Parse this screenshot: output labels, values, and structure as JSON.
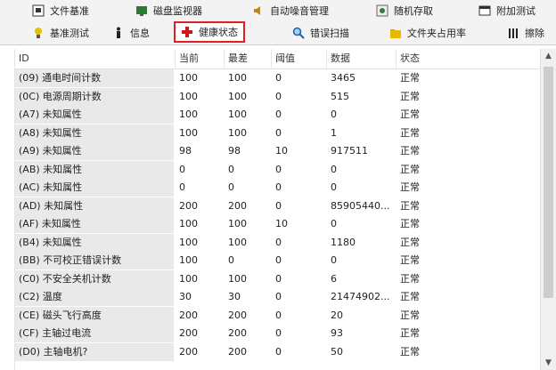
{
  "tabs": {
    "row1": [
      {
        "label": "文件基准",
        "icon": "benchmark-file-icon"
      },
      {
        "label": "磁盘监视器",
        "icon": "disk-monitor-icon"
      },
      {
        "label": "自动噪音管理",
        "icon": "speaker-icon"
      },
      {
        "label": "随机存取",
        "icon": "random-access-icon"
      },
      {
        "label": "附加测试",
        "icon": "extra-tests-icon"
      }
    ],
    "row2": [
      {
        "label": "基准测试",
        "icon": "lightbulb-icon"
      },
      {
        "label": "信息",
        "icon": "info-icon"
      },
      {
        "label": "健康状态",
        "icon": "red-cross-icon",
        "active": true
      },
      {
        "label": "错误扫描",
        "icon": "magnifier-icon"
      },
      {
        "label": "文件夹占用率",
        "icon": "folder-icon"
      },
      {
        "label": "擦除",
        "icon": "erase-icon"
      }
    ]
  },
  "table": {
    "columns": [
      "ID",
      "当前",
      "最差",
      "阈值",
      "数据",
      "状态"
    ],
    "rows": [
      [
        "(09) 通电时间计数",
        "100",
        "100",
        "0",
        "3465",
        "正常"
      ],
      [
        "(0C) 电源周期计数",
        "100",
        "100",
        "0",
        "515",
        "正常"
      ],
      [
        "(A7) 未知属性",
        "100",
        "100",
        "0",
        "0",
        "正常"
      ],
      [
        "(A8) 未知属性",
        "100",
        "100",
        "0",
        "1",
        "正常"
      ],
      [
        "(A9) 未知属性",
        "98",
        "98",
        "10",
        "917511",
        "正常"
      ],
      [
        "(AB) 未知属性",
        "0",
        "0",
        "0",
        "0",
        "正常"
      ],
      [
        "(AC) 未知属性",
        "0",
        "0",
        "0",
        "0",
        "正常"
      ],
      [
        "(AD) 未知属性",
        "200",
        "200",
        "0",
        "85905440...",
        "正常"
      ],
      [
        "(AF) 未知属性",
        "100",
        "100",
        "10",
        "0",
        "正常"
      ],
      [
        "(B4) 未知属性",
        "100",
        "100",
        "0",
        "1180",
        "正常"
      ],
      [
        "(BB) 不可校正错误计数",
        "100",
        "0",
        "0",
        "0",
        "正常"
      ],
      [
        "(C0) 不安全关机计数",
        "100",
        "100",
        "0",
        "6",
        "正常"
      ],
      [
        "(C2) 温度",
        "30",
        "30",
        "0",
        "21474902...",
        "正常"
      ],
      [
        "(CE) 磁头飞行高度",
        "200",
        "200",
        "0",
        "20",
        "正常"
      ],
      [
        "(CF) 主轴过电流",
        "200",
        "200",
        "0",
        "93",
        "正常"
      ],
      [
        "(D0) 主轴电机?",
        "200",
        "200",
        "0",
        "50",
        "正常"
      ]
    ]
  },
  "colors": {
    "accent_border": "#e02020",
    "id_column_bg": "#e9e9e9"
  }
}
